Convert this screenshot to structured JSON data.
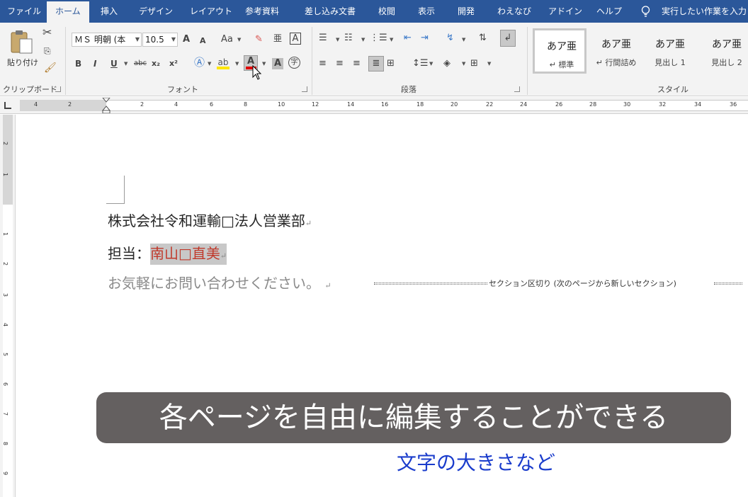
{
  "tabs": [
    {
      "label": "ファイル",
      "active": false
    },
    {
      "label": "ホーム",
      "active": true
    },
    {
      "label": "挿入",
      "active": false
    },
    {
      "label": "デザイン",
      "active": false
    },
    {
      "label": "レイアウト",
      "active": false
    },
    {
      "label": "参考資料",
      "active": false
    },
    {
      "label": "差し込み文書",
      "active": false
    },
    {
      "label": "校閲",
      "active": false
    },
    {
      "label": "表示",
      "active": false
    },
    {
      "label": "開発",
      "active": false
    },
    {
      "label": "わえなび",
      "active": false
    },
    {
      "label": "アドイン",
      "active": false
    },
    {
      "label": "ヘルプ",
      "active": false
    }
  ],
  "tell_me": "実行したい作業を入力",
  "ribbon": {
    "clipboard": {
      "paste_label": "貼り付け",
      "group_label": "クリップボード"
    },
    "font": {
      "font_name": "ＭＳ 明朝 (本",
      "font_size": "10.5",
      "grow": "A",
      "shrink": "A",
      "case": "Aa",
      "bold": "B",
      "italic": "I",
      "underline": "U",
      "strike": "abc",
      "subscript": "x₂",
      "superscript": "x²",
      "ruby": "亜",
      "border_char": "A",
      "font_color_letter": "A",
      "shading_char": "A",
      "enclose": "字",
      "group_label": "フォント"
    },
    "paragraph": {
      "group_label": "段落"
    },
    "styles": {
      "items": [
        {
          "sample": "あア亜",
          "name": "↵ 標準"
        },
        {
          "sample": "あア亜",
          "name": "↵ 行間詰め"
        },
        {
          "sample": "あア亜",
          "name": "見出し 1"
        },
        {
          "sample": "あア亜",
          "name": "見出し 2"
        }
      ],
      "group_label": "スタイル"
    }
  },
  "ruler": {
    "h_numbers": [
      "4",
      "2",
      "2",
      "4",
      "6",
      "8",
      "10",
      "12",
      "14",
      "16",
      "18",
      "20",
      "22",
      "24",
      "26",
      "28",
      "30",
      "32",
      "34",
      "36"
    ],
    "v_numbers": [
      "2",
      "1",
      "1",
      "2",
      "3",
      "4",
      "5",
      "6",
      "7",
      "8",
      "9"
    ]
  },
  "document": {
    "line1": "株式会社令和運輸□法人営業部",
    "line2_prefix": "担当：",
    "line2_name": "南山□直美",
    "line3": "お気軽にお問い合わせください。",
    "paragraph_mark": "↵",
    "section_break": "セクション区切り (次のページから新しいセクション)"
  },
  "caption": "各ページを自由に編集することができる",
  "subcaption": "文字の大きさなど",
  "colors": {
    "tab_bar": "#2b579a",
    "highlight_name": "#c0392b",
    "caption_bg": "#646060",
    "subcaption": "#1a3ccc"
  }
}
